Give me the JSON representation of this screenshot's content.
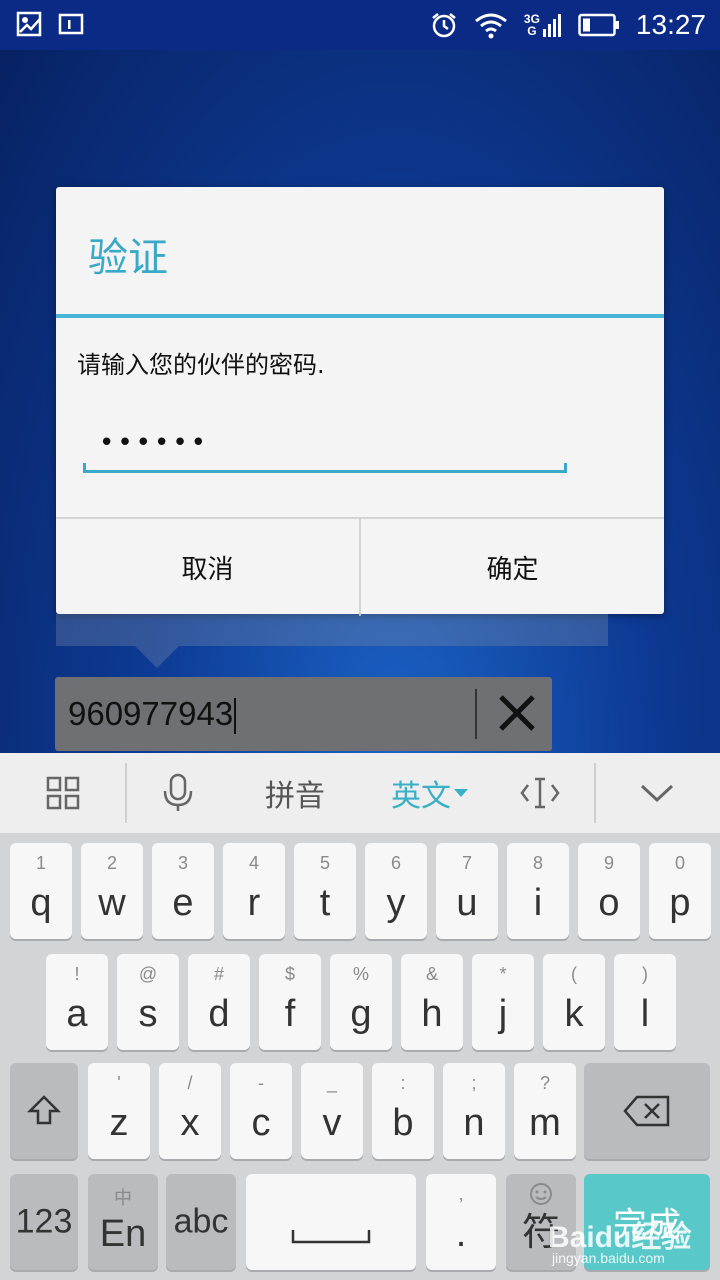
{
  "status_bar": {
    "time": "13:27",
    "network_top": "3G",
    "network_bottom": "G"
  },
  "dialog": {
    "title": "验证",
    "message": "请输入您的伙伴的密码.",
    "password_masked": "••••••",
    "cancel_label": "取消",
    "ok_label": "确定"
  },
  "id_field": {
    "value": "960977943"
  },
  "ime_toolbar": {
    "pinyin_label": "拼音",
    "english_label": "英文"
  },
  "keyboard": {
    "row1": [
      {
        "sub": "1",
        "main": "q"
      },
      {
        "sub": "2",
        "main": "w"
      },
      {
        "sub": "3",
        "main": "e"
      },
      {
        "sub": "4",
        "main": "r"
      },
      {
        "sub": "5",
        "main": "t"
      },
      {
        "sub": "6",
        "main": "y"
      },
      {
        "sub": "7",
        "main": "u"
      },
      {
        "sub": "8",
        "main": "i"
      },
      {
        "sub": "9",
        "main": "o"
      },
      {
        "sub": "0",
        "main": "p"
      }
    ],
    "row2": [
      {
        "sub": "!",
        "main": "a"
      },
      {
        "sub": "@",
        "main": "s"
      },
      {
        "sub": "#",
        "main": "d"
      },
      {
        "sub": "$",
        "main": "f"
      },
      {
        "sub": "%",
        "main": "g"
      },
      {
        "sub": "&",
        "main": "h"
      },
      {
        "sub": "*",
        "main": "j"
      },
      {
        "sub": "(",
        "main": "k"
      },
      {
        "sub": ")",
        "main": "l"
      }
    ],
    "row3": [
      {
        "sub": "'",
        "main": "z"
      },
      {
        "sub": "/",
        "main": "x"
      },
      {
        "sub": "-",
        "main": "c"
      },
      {
        "sub": "_",
        "main": "v"
      },
      {
        "sub": ":",
        "main": "b"
      },
      {
        "sub": ";",
        "main": "n"
      },
      {
        "sub": "?",
        "main": "m"
      }
    ],
    "key_123": "123",
    "key_en_sub": "中",
    "key_en_main": "En",
    "key_abc": "abc",
    "key_comma": ",",
    "key_period": ".",
    "key_symbol": "符",
    "key_done": "完成"
  },
  "watermark": {
    "logo": "Baidu经验",
    "url": "jingyan.baidu.com"
  },
  "colors": {
    "accent": "#3aa9c8",
    "status_bar": "#0b2a86",
    "done_key": "#58c8c8"
  }
}
